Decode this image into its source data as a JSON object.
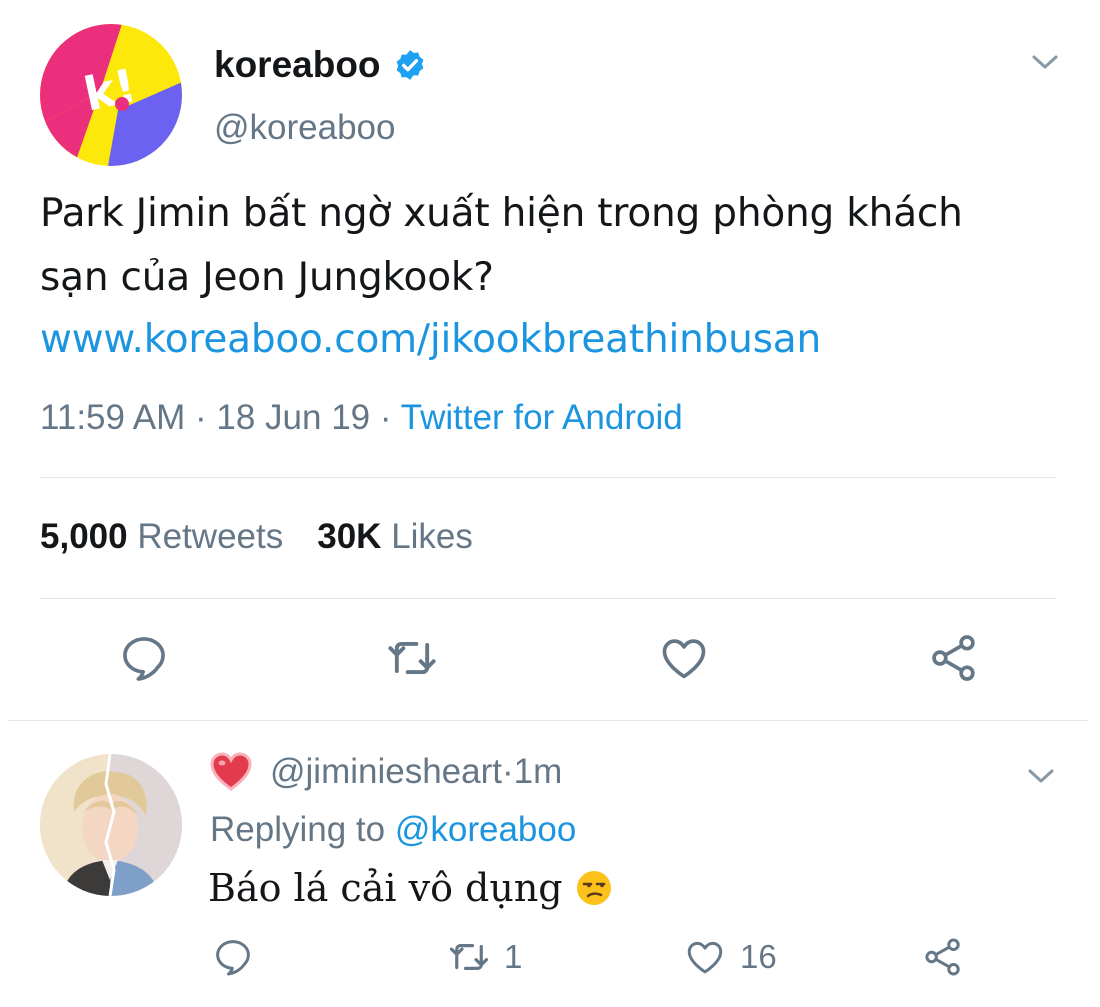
{
  "tweet": {
    "display_name": "koreaboo",
    "handle": "@koreaboo",
    "text": "Park Jimin bất ngờ xuất hiện trong phòng khách sạn của Jeon Jungkook?",
    "link": "www.koreaboo.com/jikookbreathinbusan",
    "time": "11:59 AM",
    "separator": " · ",
    "date": "18 Jun 19",
    "source": "Twitter for Android",
    "retweet_count": "5,000",
    "retweet_label": "Retweets",
    "like_count": "30K",
    "like_label": "Likes",
    "avatar_letter": "k!",
    "icons": [
      "verified-badge-icon",
      "chevron-down-icon",
      "reply-icon",
      "retweet-icon",
      "like-icon",
      "share-icon"
    ]
  },
  "reply": {
    "handle": "@jiminiesheart",
    "age_prefix": " · ",
    "age": "1m",
    "replying_to_label": "Replying to ",
    "replying_to_handle": "@koreaboo",
    "text": "Báo lá cải vô dụng",
    "retweet_count": "1",
    "like_count": "16",
    "icons": [
      "heart-emoji-icon",
      "unamused-emoji-icon",
      "chevron-down-icon",
      "reply-icon",
      "retweet-icon",
      "like-icon",
      "share-icon"
    ]
  },
  "colors": {
    "text": "#14171a",
    "secondary": "#657786",
    "link": "#1b95e0",
    "divider": "#e1e8ed",
    "verified": "#1da1f2",
    "logo_pink": "#ec2f7d",
    "logo_yellow": "#fce80b",
    "logo_purple": "#6b62f2"
  }
}
